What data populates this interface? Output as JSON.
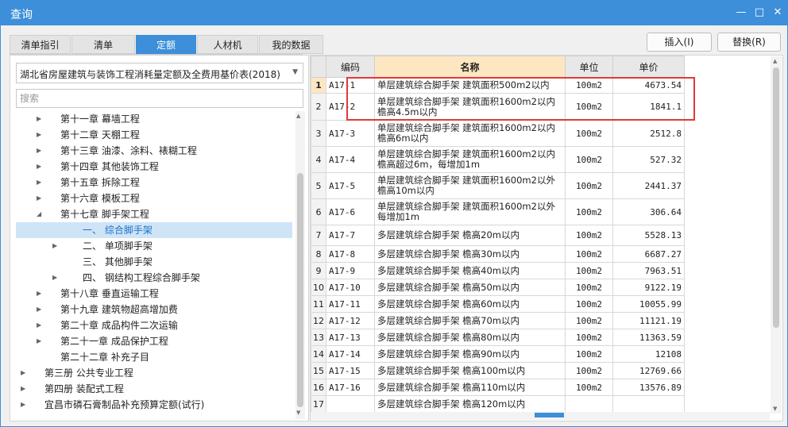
{
  "window": {
    "title": "查询"
  },
  "tabs": [
    "清单指引",
    "清单",
    "定额",
    "人材机",
    "我的数据"
  ],
  "active_tab": 2,
  "buttons": {
    "insert": "插入(I)",
    "replace": "替换(R)"
  },
  "left": {
    "library": "湖北省房屋建筑与装饰工程消耗量定额及全费用基价表(2018)",
    "search_placeholder": "搜索",
    "tree": [
      {
        "label": "第十一章 幕墙工程",
        "level": 1,
        "caret": "right"
      },
      {
        "label": "第十二章 天棚工程",
        "level": 1,
        "caret": "right"
      },
      {
        "label": "第十三章 油漆、涂料、裱糊工程",
        "level": 1,
        "caret": "right"
      },
      {
        "label": "第十四章 其他装饰工程",
        "level": 1,
        "caret": "right"
      },
      {
        "label": "第十五章 拆除工程",
        "level": 1,
        "caret": "right"
      },
      {
        "label": "第十六章 模板工程",
        "level": 1,
        "caret": "right"
      },
      {
        "label": "第十七章 脚手架工程",
        "level": 1,
        "caret": "down"
      },
      {
        "label": "一、 综合脚手架",
        "level": 2,
        "caret": "",
        "selected": true
      },
      {
        "label": "二、 单项脚手架",
        "level": 2,
        "caret": "right"
      },
      {
        "label": "三、 其他脚手架",
        "level": 2,
        "caret": ""
      },
      {
        "label": "四、 钢结构工程综合脚手架",
        "level": 2,
        "caret": "right"
      },
      {
        "label": "第十八章 垂直运输工程",
        "level": 1,
        "caret": "right"
      },
      {
        "label": "第十九章 建筑物超高增加费",
        "level": 1,
        "caret": "right"
      },
      {
        "label": "第二十章 成品构件二次运输",
        "level": 1,
        "caret": "right"
      },
      {
        "label": "第二十一章 成品保护工程",
        "level": 1,
        "caret": "right"
      },
      {
        "label": "第二十二章 补充子目",
        "level": 1,
        "caret": ""
      },
      {
        "label": "第三册 公共专业工程",
        "level": 0,
        "caret": "right"
      },
      {
        "label": "第四册 装配式工程",
        "level": 0,
        "caret": "right"
      },
      {
        "label": "宜昌市磷石膏制品补充预算定额(试行)",
        "level": 0,
        "caret": "right"
      }
    ]
  },
  "table": {
    "headers": {
      "code": "编码",
      "name": "名称",
      "unit": "单位",
      "price": "单价"
    },
    "rows": [
      {
        "no": "1",
        "code": "A17-1",
        "name": "单层建筑综合脚手架 建筑面积500m2以内",
        "unit": "100m2",
        "price": "4673.54"
      },
      {
        "no": "2",
        "code": "A17-2",
        "name": "单层建筑综合脚手架 建筑面积1600m2以内 檐高4.5m以内",
        "unit": "100m2",
        "price": "1841.1"
      },
      {
        "no": "3",
        "code": "A17-3",
        "name": "单层建筑综合脚手架 建筑面积1600m2以内 檐高6m以内",
        "unit": "100m2",
        "price": "2512.8"
      },
      {
        "no": "4",
        "code": "A17-4",
        "name": "单层建筑综合脚手架 建筑面积1600m2以内 檐高超过6m，每增加1m",
        "unit": "100m2",
        "price": "527.32"
      },
      {
        "no": "5",
        "code": "A17-5",
        "name": "单层建筑综合脚手架 建筑面积1600m2以外 檐高10m以内",
        "unit": "100m2",
        "price": "2441.37"
      },
      {
        "no": "6",
        "code": "A17-6",
        "name": "单层建筑综合脚手架 建筑面积1600m2以外 每增加1m",
        "unit": "100m2",
        "price": "306.64"
      },
      {
        "no": "7",
        "code": "A17-7",
        "name": "多层建筑综合脚手架 檐高20m以内",
        "unit": "100m2",
        "price": "5528.13"
      },
      {
        "no": "8",
        "code": "A17-8",
        "name": "多层建筑综合脚手架 檐高30m以内",
        "unit": "100m2",
        "price": "6687.27"
      },
      {
        "no": "9",
        "code": "A17-9",
        "name": "多层建筑综合脚手架 檐高40m以内",
        "unit": "100m2",
        "price": "7963.51"
      },
      {
        "no": "10",
        "code": "A17-10",
        "name": "多层建筑综合脚手架 檐高50m以内",
        "unit": "100m2",
        "price": "9122.19"
      },
      {
        "no": "11",
        "code": "A17-11",
        "name": "多层建筑综合脚手架 檐高60m以内",
        "unit": "100m2",
        "price": "10055.99"
      },
      {
        "no": "12",
        "code": "A17-12",
        "name": "多层建筑综合脚手架 檐高70m以内",
        "unit": "100m2",
        "price": "11121.19"
      },
      {
        "no": "13",
        "code": "A17-13",
        "name": "多层建筑综合脚手架 檐高80m以内",
        "unit": "100m2",
        "price": "11363.59"
      },
      {
        "no": "14",
        "code": "A17-14",
        "name": "多层建筑综合脚手架 檐高90m以内",
        "unit": "100m2",
        "price": "12108"
      },
      {
        "no": "15",
        "code": "A17-15",
        "name": "多层建筑综合脚手架 檐高100m以内",
        "unit": "100m2",
        "price": "12769.66"
      },
      {
        "no": "16",
        "code": "A17-16",
        "name": "多层建筑综合脚手架 檐高110m以内",
        "unit": "100m2",
        "price": "13576.89"
      },
      {
        "no": "17",
        "code": "",
        "name": "多层建筑综合脚手架 檐高120m以内",
        "unit": "",
        "price": ""
      }
    ]
  }
}
